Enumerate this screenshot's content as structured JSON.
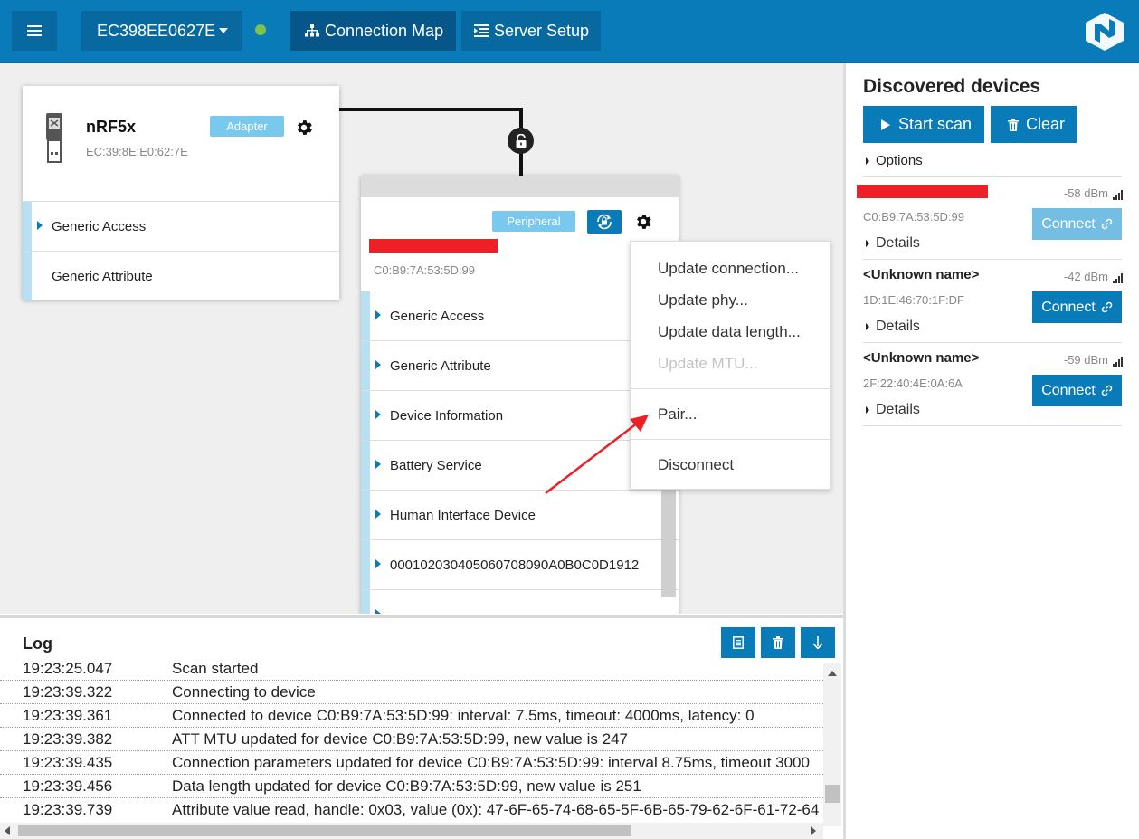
{
  "topbar": {
    "device": "EC398EE0627E",
    "tabs": [
      {
        "label": "Connection Map",
        "active": true
      },
      {
        "label": "Server Setup",
        "active": false
      }
    ],
    "status_color": "#7ec24a"
  },
  "adapter": {
    "name": "nRF5x",
    "address": "EC:39:8E:E0:62:7E",
    "badge": "Adapter",
    "services": [
      "Generic Access",
      "Generic Attribute"
    ]
  },
  "peripheral": {
    "badge": "Peripheral",
    "address": "C0:B9:7A:53:5D:99",
    "services": [
      "Generic Access",
      "Generic Attribute",
      "Device Information",
      "Battery Service",
      "Human Interface Device",
      "000102030405060708090A0B0C0D1912"
    ]
  },
  "context_menu": {
    "items": [
      {
        "label": "Update connection...",
        "enabled": true
      },
      {
        "label": "Update phy...",
        "enabled": true
      },
      {
        "label": "Update data length...",
        "enabled": true
      },
      {
        "label": "Update MTU...",
        "enabled": false
      },
      {
        "label": "Pair...",
        "enabled": true
      },
      {
        "label": "Disconnect",
        "enabled": true
      }
    ]
  },
  "log": {
    "title": "Log",
    "entries": [
      {
        "time": "19:23:25.047",
        "message": "Scan started"
      },
      {
        "time": "19:23:39.322",
        "message": "Connecting to device"
      },
      {
        "time": "19:23:39.361",
        "message": "Connected to device C0:B9:7A:53:5D:99: interval: 7.5ms, timeout: 4000ms, latency: 0"
      },
      {
        "time": "19:23:39.382",
        "message": "ATT MTU updated for device C0:B9:7A:53:5D:99, new value is 247"
      },
      {
        "time": "19:23:39.435",
        "message": "Connection parameters updated for device C0:B9:7A:53:5D:99: interval 8.75ms, timeout 3000"
      },
      {
        "time": "19:23:39.456",
        "message": "Data length updated for device C0:B9:7A:53:5D:99, new value is 251"
      },
      {
        "time": "19:23:39.739",
        "message": "Attribute value read, handle: 0x03, value (0x): 47-6F-65-74-68-65-5F-6B-65-79-62-6F-61-72-64"
      }
    ]
  },
  "discovered": {
    "title": "Discovered devices",
    "start_scan": "Start scan",
    "clear": "Clear",
    "options": "Options",
    "devices": [
      {
        "name": "",
        "rssi": "-58 dBm",
        "address": "C0:B9:7A:53:5D:99",
        "connect": "Connect",
        "details": "Details"
      },
      {
        "name": "<Unknown name>",
        "rssi": "-42 dBm",
        "address": "1D:1E:46:70:1F:DF",
        "connect": "Connect",
        "details": "Details"
      },
      {
        "name": "<Unknown name>",
        "rssi": "-59 dBm",
        "address": "2F:22:40:4E:0A:6A",
        "connect": "Connect",
        "details": "Details"
      }
    ]
  },
  "colors": {
    "primary": "#0a7bb9",
    "dark": "#06568a",
    "badge": "#79c8ee",
    "redaction": "#ee2027"
  }
}
